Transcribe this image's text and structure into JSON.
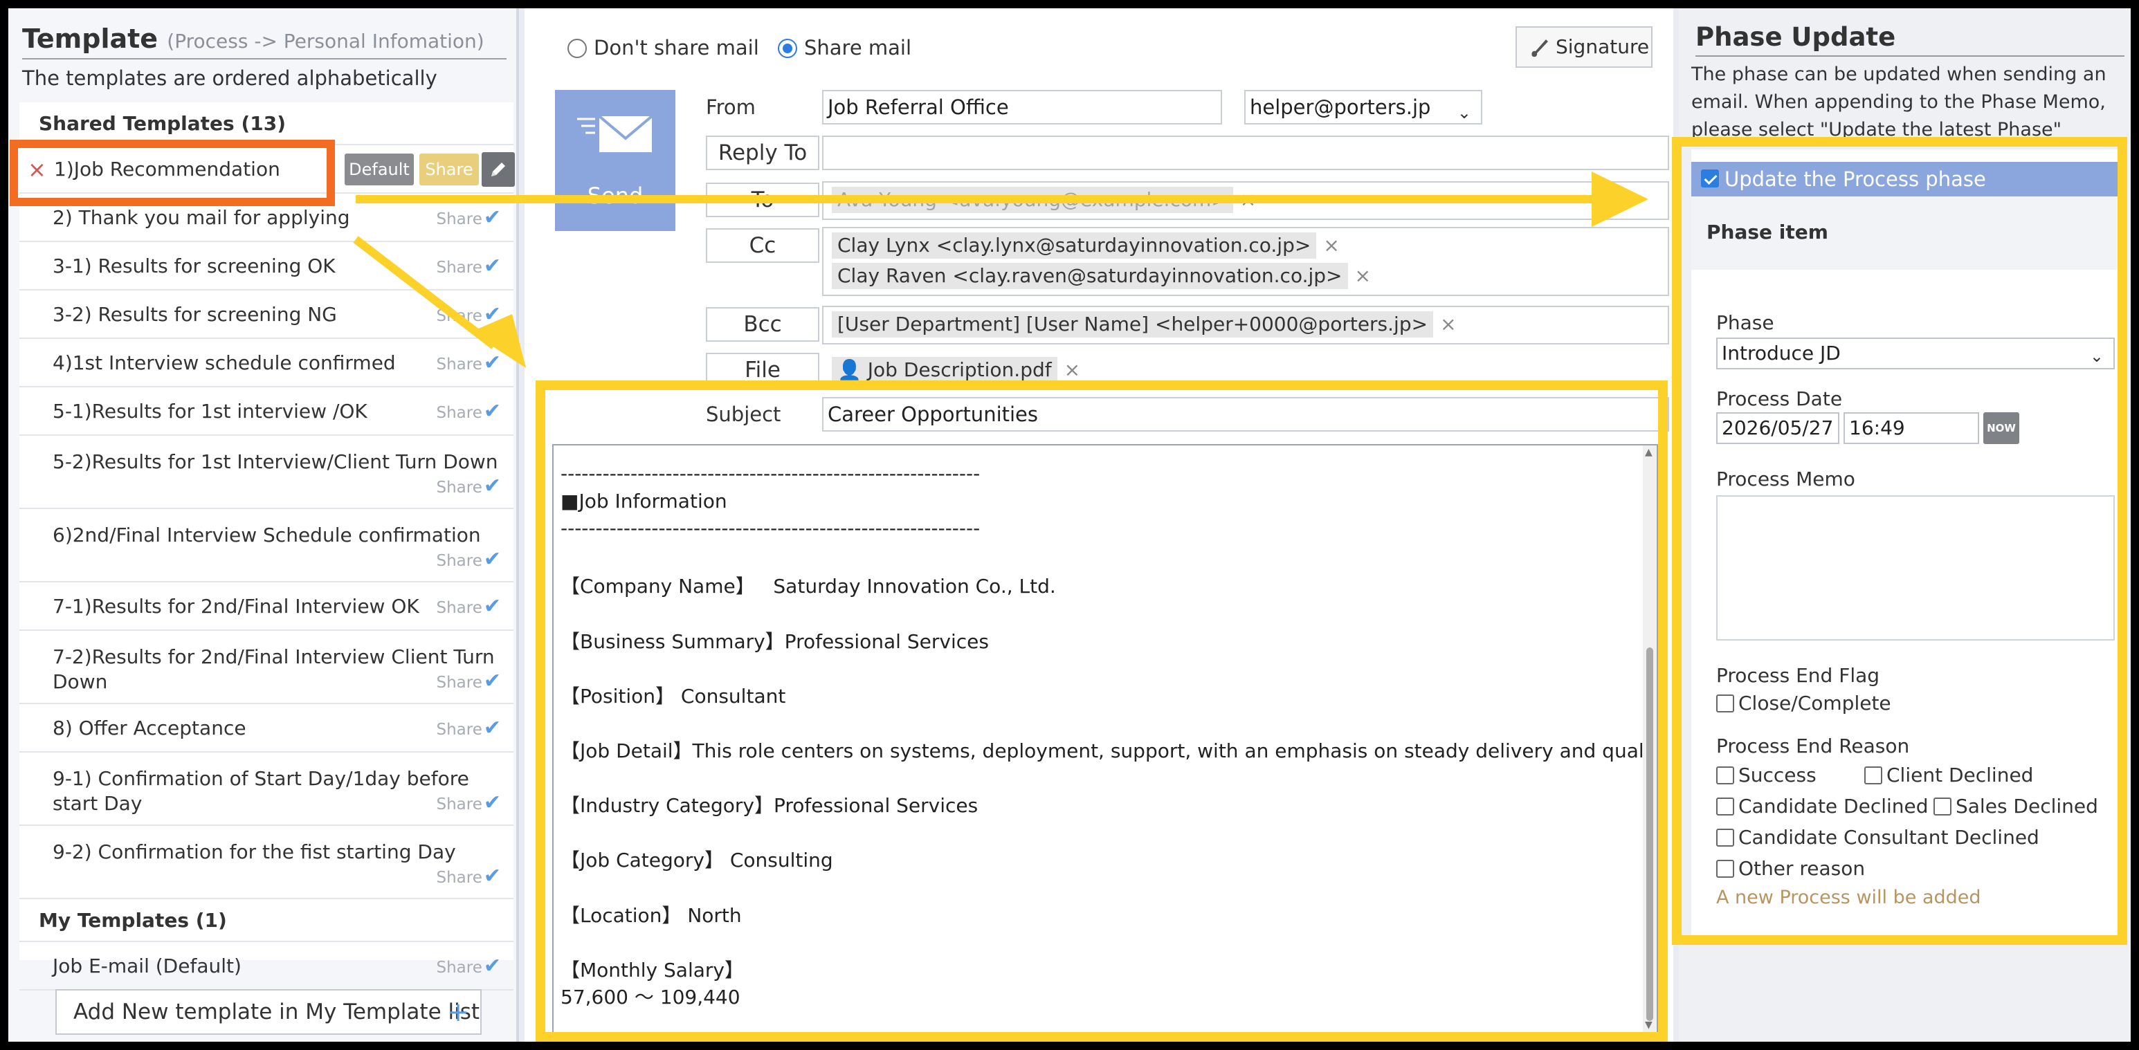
{
  "left": {
    "title": "Template",
    "title_sub": "(Process -> Personal Infomation)",
    "description": "The templates are ordered alphabetically",
    "shared_heading": "Shared Templates (13)",
    "active_item": {
      "label": "1)Job Recommendation",
      "default_label": "Default",
      "share_label": "Share"
    },
    "shared_items": [
      {
        "label": "2) Thank you mail for applying",
        "share": "Share"
      },
      {
        "label": "3-1) Results for screening OK",
        "share": "Share"
      },
      {
        "label": "3-2) Results for screening NG",
        "share": "Share"
      },
      {
        "label": "4)1st Interview schedule confirmed",
        "share": "Share"
      },
      {
        "label": "5-1)Results for 1st interview /OK",
        "share": "Share"
      },
      {
        "label": "5-2)Results for 1st Interview/Client Turn Down",
        "share": "Share"
      },
      {
        "label": "6)2nd/Final Interview Schedule confirmation",
        "share": "Share"
      },
      {
        "label": "7-1)Results for 2nd/Final Interview OK",
        "share": "Share"
      },
      {
        "label": "7-2)Results for 2nd/Final Interview Client Turn Down",
        "share": "Share"
      },
      {
        "label": "8) Offer Acceptance",
        "share": "Share"
      },
      {
        "label": "9-1) Confirmation of Start Day/1day before start Day",
        "share": "Share"
      },
      {
        "label": "9-2) Confirmation for the fist starting Day",
        "share": "Share"
      }
    ],
    "my_heading": "My Templates (1)",
    "my_items": [
      {
        "label": "Job E-mail (Default)",
        "share": "Share"
      }
    ],
    "add_button": "Add New template in My Template list",
    "add_plus": "+"
  },
  "compose": {
    "radio_dont": "Don't share mail",
    "radio_share": "Share mail",
    "selected_radio": "share",
    "signature": "Signature",
    "send": "Send",
    "from_label": "From",
    "from_name": "Job Referral Office",
    "from_address": "helper@porters.jp",
    "reply_to_label": "Reply To",
    "reply_to_value": "",
    "to_label": "To",
    "to_chips": [
      "Ava Young <ava.young@example.com>"
    ],
    "cc_label": "Cc",
    "cc_chips": [
      "Clay Lynx <clay.lynx@saturdayinnovation.co.jp>",
      "Clay Raven <clay.raven@saturdayinnovation.co.jp>"
    ],
    "bcc_label": "Bcc",
    "bcc_chips": [
      "[User Department] [User Name] <helper+0000@porters.jp>"
    ],
    "file_label": "File",
    "file_chips": [
      "Job Description.pdf"
    ],
    "subject_label": "Subject",
    "subject_value": "Career Opportunities",
    "body_lines": [
      "------------------------------------------------------------",
      "■Job Information",
      "------------------------------------------------------------",
      "",
      "【Company Name】   Saturday Innovation Co., Ltd.",
      "",
      "【Business Summary】Professional Services",
      "",
      "【Position】 Consultant",
      "",
      "【Job Detail】This role centers on systems, deployment, support, with an emphasis on steady delivery and quality.",
      "",
      "【Industry Category】Professional Services",
      "",
      "【Job Category】 Consulting",
      "",
      "【Location】 North",
      "",
      "【Monthly Salary】",
      "57,600 〜 109,440"
    ]
  },
  "phase": {
    "title": "Phase Update",
    "description": "The phase can be updated when sending an email. When appending to the Phase Memo, please select \"Update the latest Phase\"",
    "update_label": "Update the Process phase",
    "update_checked": true,
    "item_heading": "Phase item",
    "phase_label": "Phase",
    "phase_value": "Introduce JD",
    "date_label": "Process Date",
    "date_value": "2026/05/27",
    "time_value": "16:49",
    "now_label": "NOW",
    "memo_label": "Process Memo",
    "end_flag_label": "Process End Flag",
    "close_label": "Close/Complete",
    "end_reason_label": "Process End Reason",
    "reasons": [
      "Success",
      "Client Declined",
      "Candidate Declined",
      "Sales Declined",
      "Candidate Consultant Declined",
      "Other reason"
    ],
    "note": "A new Process will be added"
  },
  "colors": {
    "highlight_orange": "#f26c22",
    "highlight_yellow": "#fcd12a",
    "send_blue": "#8aa6dc",
    "accent_blue": "#2b7de0"
  }
}
